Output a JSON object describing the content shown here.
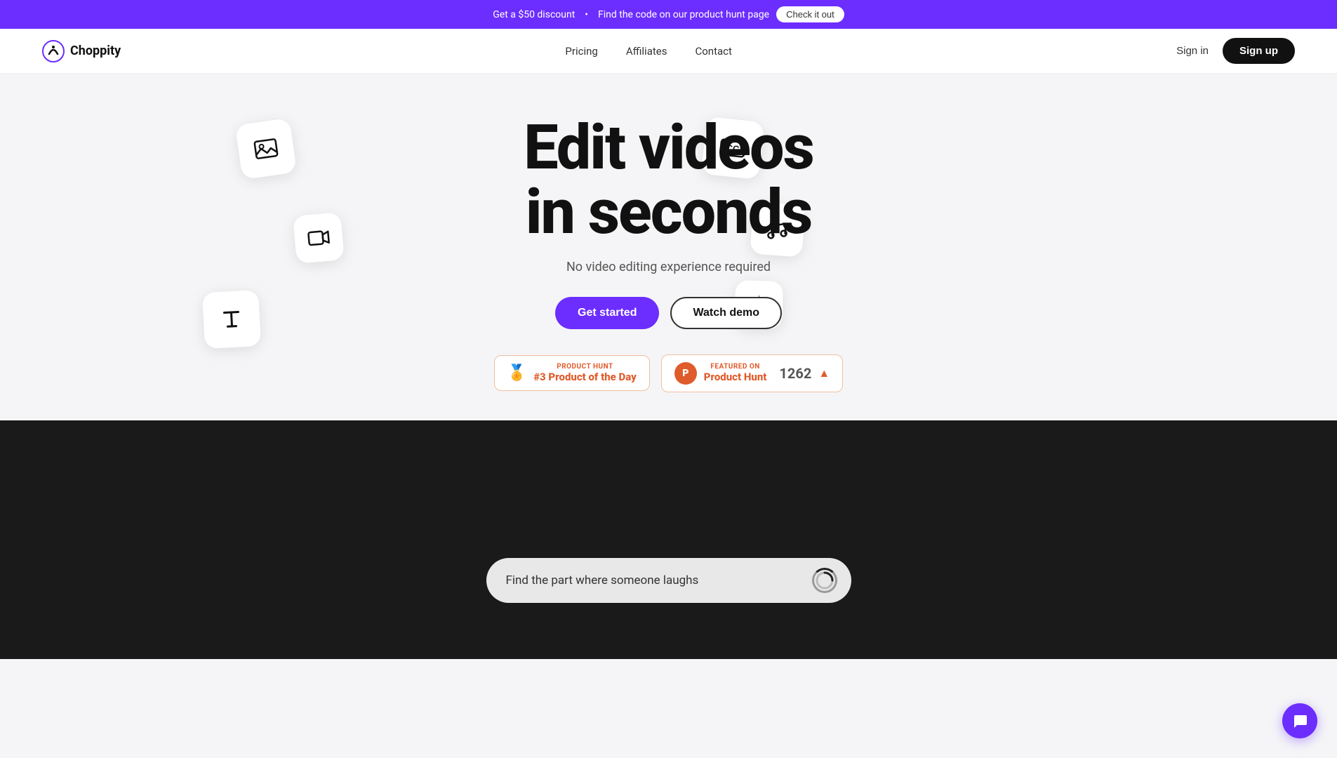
{
  "banner": {
    "discount_text": "Get a $50 discount",
    "bullet": "•",
    "find_code_text": "Find the code on our product hunt page",
    "cta_label": "Check it out"
  },
  "navbar": {
    "logo_text": "Choppity",
    "nav": {
      "pricing": "Pricing",
      "affiliates": "Affiliates",
      "contact": "Contact"
    },
    "sign_in": "Sign in",
    "sign_up": "Sign up"
  },
  "hero": {
    "title_line1": "Edit videos",
    "title_line2": "in seconds",
    "subtitle": "No video editing experience required",
    "get_started": "Get started",
    "watch_demo": "Watch demo",
    "badge1": {
      "label": "PRODUCT HUNT",
      "value": "#3 Product of the Day"
    },
    "badge2": {
      "label": "FEATURED ON",
      "value": "Product Hunt",
      "count": "1262"
    }
  },
  "icons": {
    "image_icon": "🖼",
    "video_icon": "📹",
    "text_icon": "T",
    "cc_icon": "CC",
    "music_icon": "♫",
    "sparkle_icon": "✦"
  },
  "demo": {
    "search_placeholder": "Find  the part where someone laughs"
  },
  "chat": {
    "icon": "💬"
  },
  "colors": {
    "accent": "#6c2dff",
    "product_hunt": "#e05b2b",
    "dark_bg": "#1a1a1a",
    "banner_bg": "#6c2dff"
  }
}
